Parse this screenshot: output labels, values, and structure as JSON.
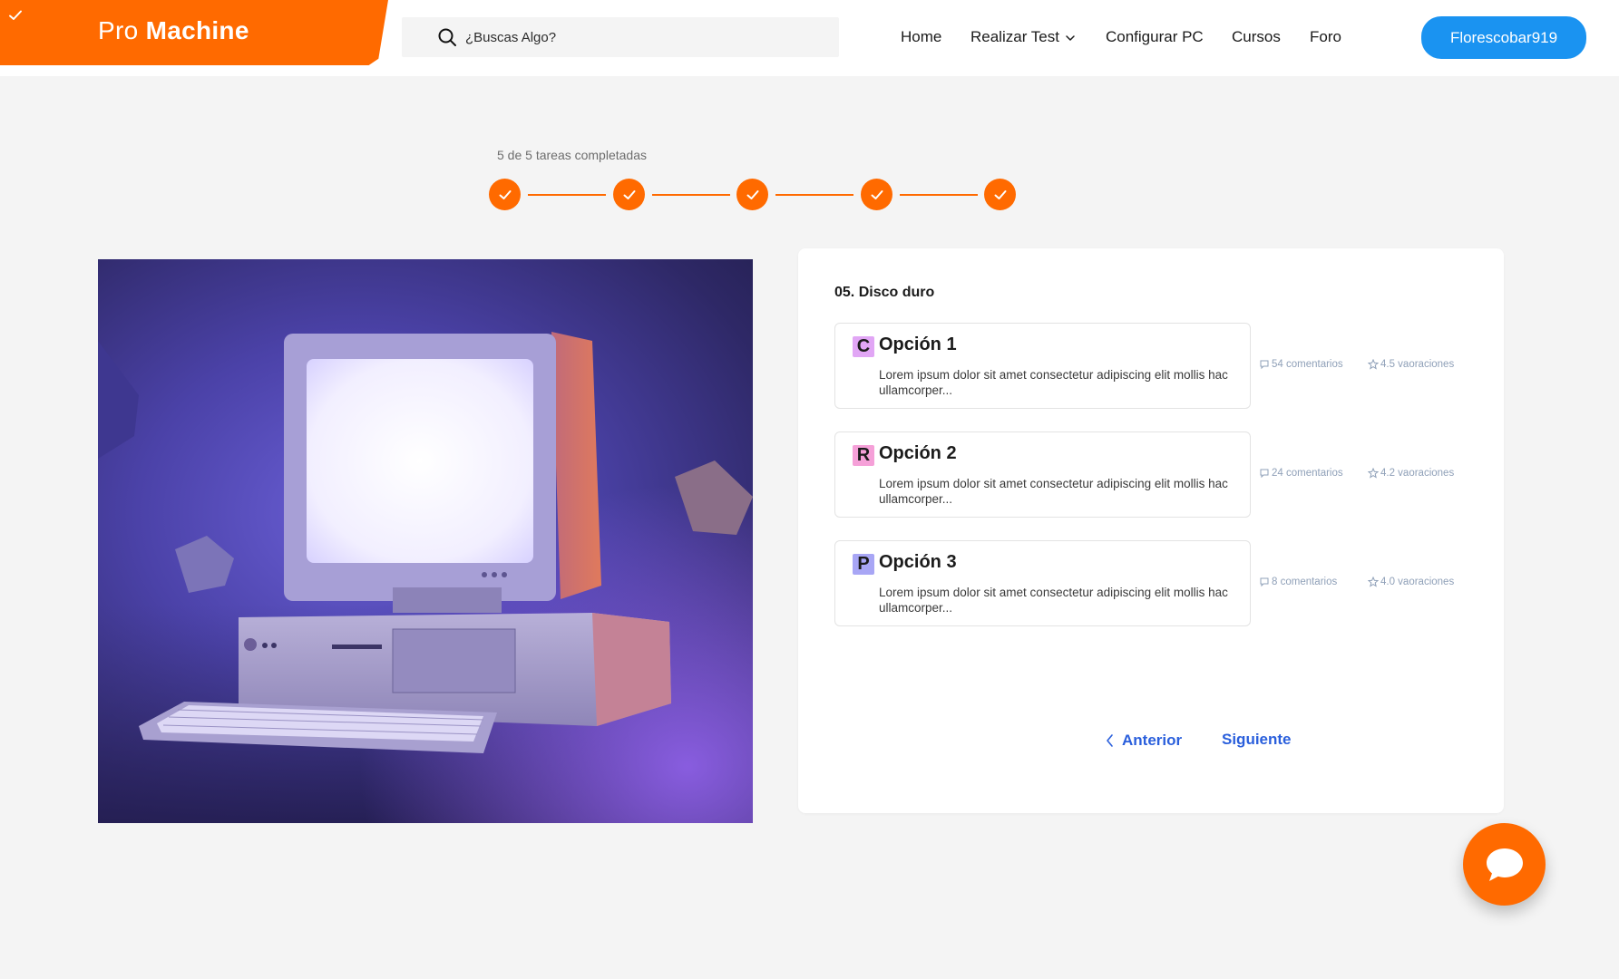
{
  "header": {
    "brand": {
      "light": "Pro",
      "bold": "Machine",
      "icon": "check-icon"
    },
    "search": {
      "placeholder": "¿Buscas Algo?",
      "icon": "search-icon"
    },
    "nav": [
      {
        "label": "Home"
      },
      {
        "label": "Realizar Test",
        "icon": "chevron-down-icon"
      },
      {
        "label": "Configurar PC"
      },
      {
        "label": "Cursos"
      },
      {
        "label": "Foro"
      }
    ],
    "user_button": "Florescobar919"
  },
  "progress": {
    "label": "5 de 5 tareas completadas",
    "completed": 5,
    "total": 5
  },
  "hero_image": {
    "description_icon": "retro-computer-illustration"
  },
  "card": {
    "title": "05. Disco duro",
    "options": [
      {
        "letter": "C",
        "letter_bg": "#e1a6f5",
        "title": "Opción 1",
        "description": "Lorem ipsum dolor sit amet consectetur adipiscing elit mollis hac ullamcorper...",
        "comments": "54 comentarios",
        "ratings": "4.5 vaoraciones"
      },
      {
        "letter": "R",
        "letter_bg": "#f5a0d8",
        "title": "Opción 2",
        "description": "Lorem ipsum dolor sit amet consectetur adipiscing elit mollis hac ullamcorper...",
        "comments": "24 comentarios",
        "ratings": "4.2 vaoraciones"
      },
      {
        "letter": "P",
        "letter_bg": "#a8a6f5",
        "title": "Opción 3",
        "description": "Lorem ipsum dolor sit amet consectetur adipiscing elit mollis hac ullamcorper...",
        "comments": "8 comentarios",
        "ratings": "4.0 vaoraciones"
      }
    ],
    "prev_label": "Anterior",
    "next_label": "Siguiente"
  },
  "chat": {
    "icon": "chat-bubble-icon"
  },
  "colors": {
    "accent": "#ff6a00",
    "primary_button": "#1a93f1",
    "link": "#2a5fdc",
    "background": "#f4f4f4"
  }
}
